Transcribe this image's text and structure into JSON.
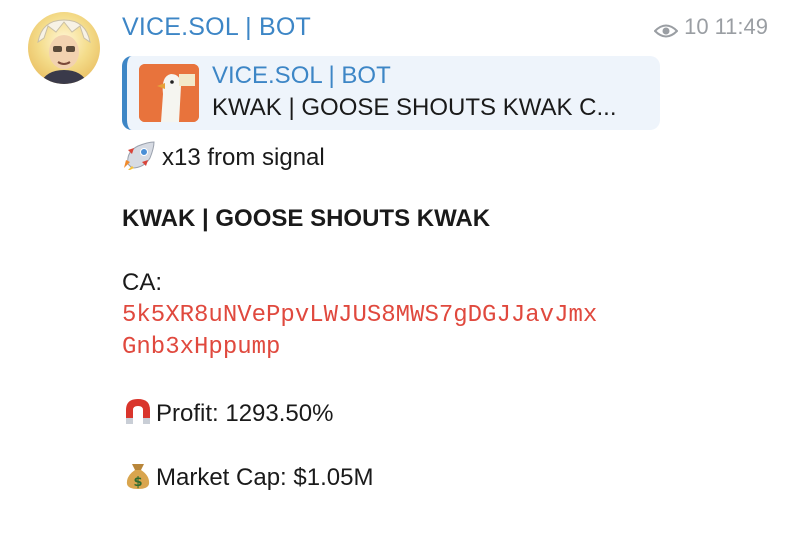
{
  "message": {
    "sender": "VICE.SOL | BOT",
    "views": "10",
    "time": "11:49",
    "reply": {
      "title": "VICE.SOL | BOT",
      "text": "KWAK | GOOSE SHOUTS KWAK  C..."
    },
    "signal_line": "x13 from signal",
    "token_name": "KWAK | GOOSE SHOUTS KWAK",
    "ca_label": "CA:",
    "ca_line1": "5k5XR8uNVePpvLWJUS8MWS7gDGJJavJmx",
    "ca_line2": "Gnb3xHppump",
    "profit": "Profit: 1293.50%",
    "market_cap": "Market Cap: $1.05M"
  },
  "icons": {
    "views": "eye-icon",
    "signal": "rocket-icon",
    "profit": "magnet-icon",
    "market_cap": "money-bag-icon"
  },
  "colors": {
    "link_blue": "#3d86c6",
    "contract_red": "#e0493e",
    "reply_bg": "#eef4fb",
    "meta_gray": "#9a9ea3"
  }
}
